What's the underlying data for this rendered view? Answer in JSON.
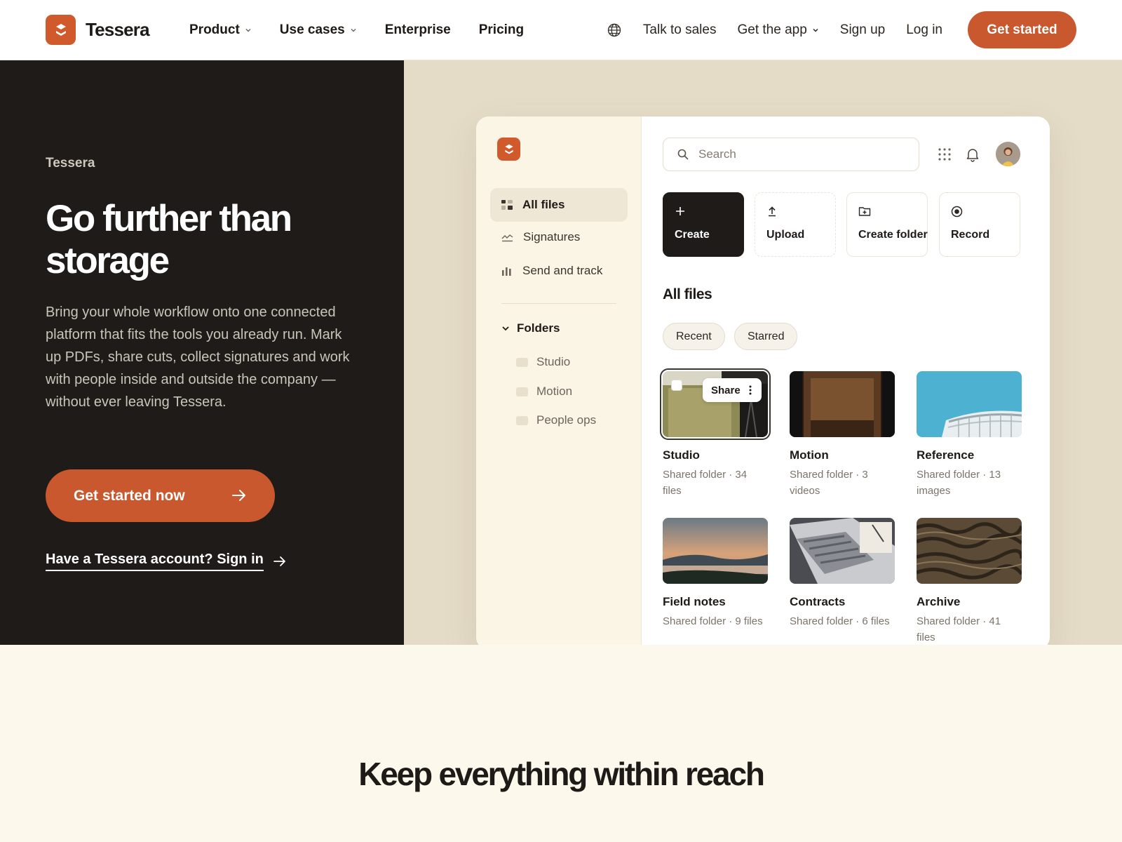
{
  "brand": {
    "name": "Tessera",
    "accent": "#c9582e",
    "dark": "#1e1b19"
  },
  "nav": {
    "left": [
      {
        "label": "Product",
        "dropdown": true
      },
      {
        "label": "Use cases",
        "dropdown": true
      },
      {
        "label": "Enterprise",
        "dropdown": false
      },
      {
        "label": "Pricing",
        "dropdown": false
      }
    ],
    "talk_to_sales": "Talk to sales",
    "get_app": "Get the app",
    "sign_up": "Sign up",
    "log_in": "Log in",
    "get_started": "Get started"
  },
  "hero": {
    "eyebrow": "Tessera",
    "title": "Go further than storage",
    "body": "Bring your whole workflow onto one connected platform that fits the tools you already run. Mark up PDFs, share cuts, collect signatures and work with people inside and outside the company — without ever leaving Tessera.",
    "cta": "Get started now",
    "signin": "Have a Tessera account? Sign in"
  },
  "app": {
    "sidebar": {
      "items": [
        {
          "label": "All files",
          "icon": "grid-icon",
          "active": true
        },
        {
          "label": "Signatures",
          "icon": "signature-icon",
          "active": false
        },
        {
          "label": "Send and track",
          "icon": "bar-chart-icon",
          "active": false
        }
      ],
      "folders_label": "Folders",
      "folders": [
        "Studio",
        "Motion",
        "People ops"
      ]
    },
    "search_placeholder": "Search",
    "actions": [
      "Create",
      "Upload",
      "Create folder",
      "Record"
    ],
    "section_title": "All files",
    "chips": [
      "Recent",
      "Starred"
    ],
    "share_label": "Share",
    "files": [
      {
        "title": "Studio",
        "meta": "Shared folder · 34 files"
      },
      {
        "title": "Motion",
        "meta": "Shared folder · 3 videos"
      },
      {
        "title": "Reference",
        "meta": "Shared folder · 13 images"
      },
      {
        "title": "Field notes",
        "meta": "Shared folder · 9 files"
      },
      {
        "title": "Contracts",
        "meta": "Shared folder · 6 files"
      },
      {
        "title": "Archive",
        "meta": "Shared folder · 41 files"
      }
    ]
  },
  "lower": {
    "title": "Keep everything within reach"
  }
}
